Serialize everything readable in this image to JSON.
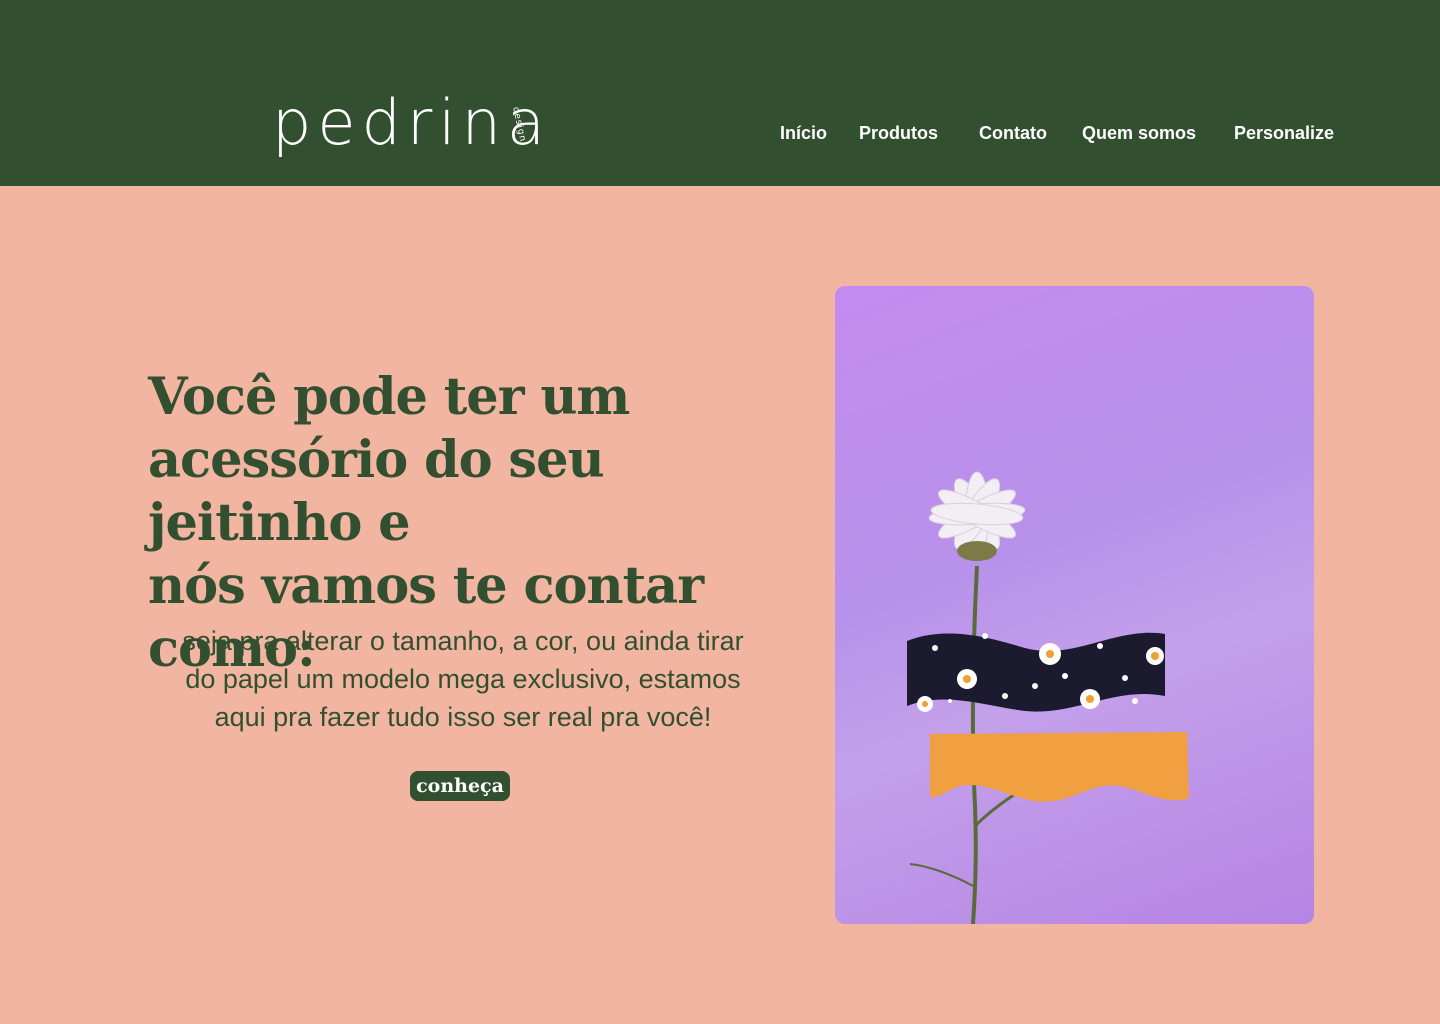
{
  "brand": {
    "name": "pedrina",
    "tagline": "design"
  },
  "nav": {
    "items": [
      "Início",
      "Produtos",
      "Contato",
      "Quem somos",
      "Personalize"
    ]
  },
  "hero": {
    "headline_lines": [
      "Você pode ter um",
      "acessório do seu jeitinho e",
      "nós vamos te contar",
      "como:"
    ],
    "description_lines": [
      "seja pra alterar o tamanho, a cor, ou ainda tirar",
      "do papel um modelo mega exclusivo, estamos",
      "aqui pra fazer tudo isso ser real pra você!"
    ],
    "cta_label": "conheça"
  },
  "colors": {
    "header_bg": "#325030",
    "page_bg": "#f1b5a2",
    "accent_text": "#325030",
    "photo_bg": "#c48cf0"
  }
}
